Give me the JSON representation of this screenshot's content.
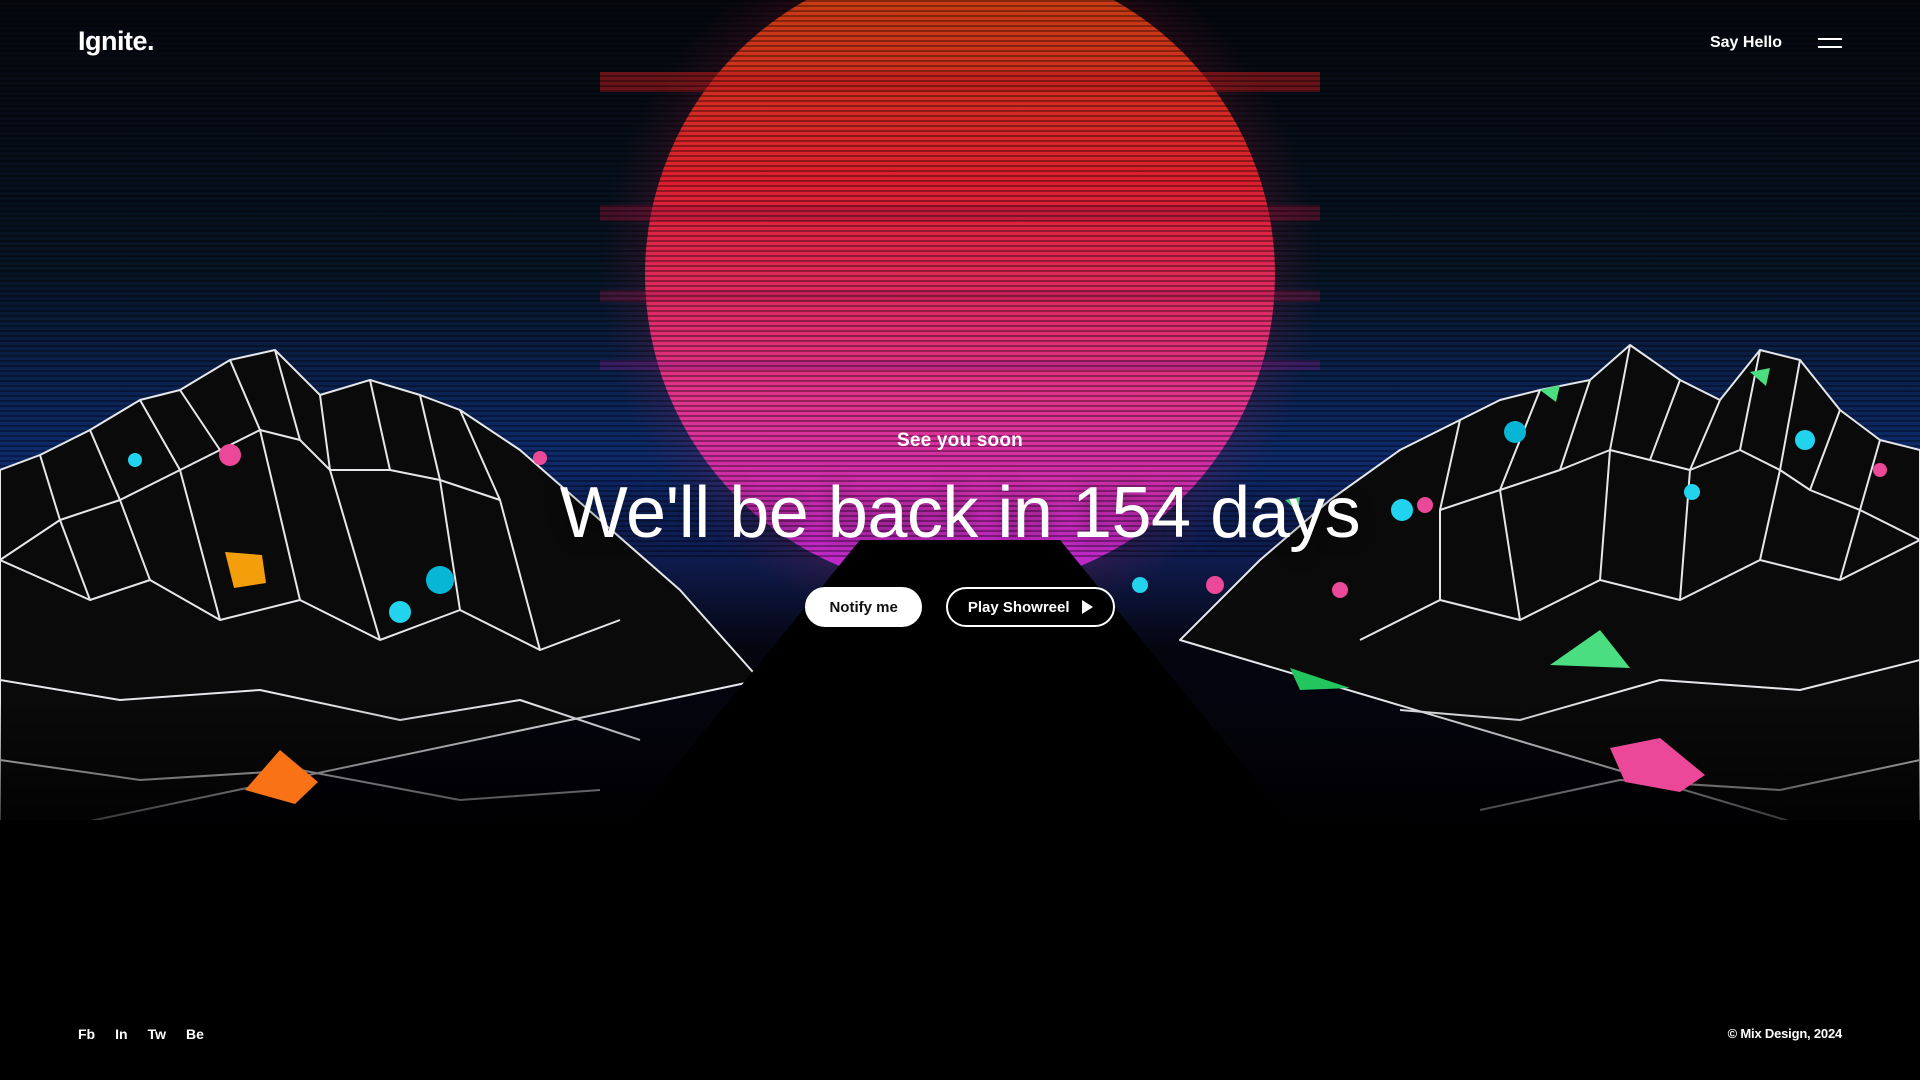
{
  "header": {
    "logo": "Ignite.",
    "say_hello": "Say Hello",
    "menu_icon": "hamburger-menu-icon"
  },
  "hero": {
    "eyebrow": "See you soon",
    "headline": "We'll be back in 154 days",
    "notify_label": "Notify me",
    "play_label": "Play Showreel",
    "play_icon": "play-icon"
  },
  "footer": {
    "socials": [
      {
        "label": "Fb"
      },
      {
        "label": "In"
      },
      {
        "label": "Tw"
      },
      {
        "label": "Be"
      }
    ],
    "copyright": "© Mix Design, 2024"
  },
  "theme": {
    "background": "#000000",
    "sun_top": "#c2410c",
    "sun_mid": "#dc1f2e",
    "sun_bottom": "#c026d3",
    "sky_glow": "#1d4ed8",
    "wireframe": "#e5e7eb",
    "text": "#ffffff"
  }
}
